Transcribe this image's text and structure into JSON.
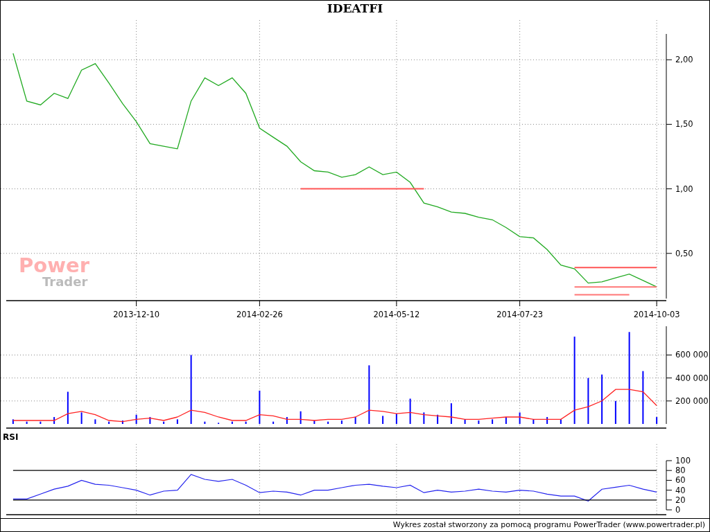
{
  "title": "IDEATFI",
  "logo": {
    "line_1": "Power",
    "line_2": "Trader"
  },
  "price_chart": {
    "chart_data": {
      "type": "line",
      "grid": true,
      "categories": [
        null,
        null,
        null,
        null,
        null,
        null,
        null,
        null,
        null,
        "2013-12-10",
        null,
        null,
        null,
        null,
        null,
        null,
        null,
        null,
        "2014-02-26",
        null,
        null,
        null,
        null,
        null,
        null,
        null,
        null,
        null,
        "2014-05-12",
        null,
        null,
        null,
        null,
        null,
        null,
        null,
        null,
        "2014-07-23",
        null,
        null,
        null,
        null,
        null,
        null,
        null,
        null,
        null,
        "2014-10-03"
      ],
      "series": [
        {
          "color": "#22aa22",
          "values": [
            2.05,
            1.68,
            1.65,
            1.74,
            1.7,
            1.92,
            1.97,
            1.82,
            1.66,
            1.52,
            1.35,
            1.33,
            1.31,
            1.68,
            1.86,
            1.8,
            1.86,
            1.74,
            1.47,
            1.4,
            1.33,
            1.21,
            1.14,
            1.13,
            1.09,
            1.11,
            1.17,
            1.11,
            1.13,
            1.05,
            0.89,
            0.86,
            0.82,
            0.81,
            0.78,
            0.76,
            0.7,
            0.63,
            0.62,
            0.53,
            0.41,
            0.38,
            0.27,
            0.28,
            0.31,
            0.34,
            0.29,
            0.24
          ]
        },
        {
          "color": "#ff5555",
          "values": [
            null,
            null,
            null,
            null,
            null,
            null,
            null,
            null,
            null,
            null,
            null,
            null,
            null,
            null,
            null,
            null,
            null,
            null,
            null,
            null,
            null,
            1.0,
            1.0,
            1.0,
            1.0,
            1.0,
            1.0,
            1.0,
            1.0,
            1.0,
            1.0,
            null,
            null,
            null,
            null,
            null,
            null,
            null,
            null,
            null,
            null,
            null,
            null,
            null,
            null,
            null,
            null,
            null
          ]
        },
        {
          "color": "#ff5555",
          "values": [
            null,
            null,
            null,
            null,
            null,
            null,
            null,
            null,
            null,
            null,
            null,
            null,
            null,
            null,
            null,
            null,
            null,
            null,
            null,
            null,
            null,
            null,
            null,
            null,
            null,
            null,
            null,
            null,
            null,
            null,
            null,
            null,
            null,
            null,
            null,
            null,
            null,
            null,
            null,
            null,
            null,
            0.39,
            0.39,
            0.39,
            0.39,
            0.39,
            0.39,
            0.39
          ]
        },
        {
          "color": "#ff7777",
          "values": [
            null,
            null,
            null,
            null,
            null,
            null,
            null,
            null,
            null,
            null,
            null,
            null,
            null,
            null,
            null,
            null,
            null,
            null,
            null,
            null,
            null,
            null,
            null,
            null,
            null,
            null,
            null,
            null,
            null,
            null,
            null,
            null,
            null,
            null,
            null,
            null,
            null,
            null,
            null,
            null,
            null,
            0.24,
            0.24,
            0.24,
            0.24,
            0.24,
            0.24,
            0.24
          ]
        },
        {
          "color": "#ff7777",
          "values": [
            null,
            null,
            null,
            null,
            null,
            null,
            null,
            null,
            null,
            null,
            null,
            null,
            null,
            null,
            null,
            null,
            null,
            null,
            null,
            null,
            null,
            null,
            null,
            null,
            null,
            null,
            null,
            null,
            null,
            null,
            null,
            null,
            null,
            null,
            null,
            null,
            null,
            null,
            null,
            null,
            null,
            0.18,
            0.18,
            0.18,
            0.18,
            0.18,
            null,
            null
          ]
        }
      ],
      "ylim": [
        0.15,
        2.2
      ],
      "yticks": [
        {
          "value": 0.5,
          "label": "0,50"
        },
        {
          "value": 1.0,
          "label": "1,00"
        },
        {
          "value": 1.5,
          "label": "1,50"
        },
        {
          "value": 2.0,
          "label": "2,00"
        }
      ]
    }
  },
  "volume_chart": {
    "chart_data": {
      "type": "bar",
      "grid": true,
      "categories": [
        null,
        null,
        null,
        null,
        null,
        null,
        null,
        null,
        null,
        null,
        null,
        null,
        null,
        null,
        null,
        null,
        null,
        null,
        null,
        null,
        null,
        null,
        null,
        null,
        null,
        null,
        null,
        null,
        null,
        null,
        null,
        null,
        null,
        null,
        null,
        null,
        null,
        null,
        null,
        null,
        null,
        null,
        null,
        null,
        null,
        null,
        null,
        null
      ],
      "series": [
        {
          "color": "#0000ff",
          "values": [
            40000,
            20000,
            20000,
            60000,
            280000,
            100000,
            40000,
            20000,
            30000,
            80000,
            60000,
            20000,
            40000,
            600000,
            20000,
            10000,
            20000,
            20000,
            290000,
            20000,
            60000,
            110000,
            30000,
            20000,
            30000,
            60000,
            510000,
            70000,
            90000,
            220000,
            100000,
            80000,
            180000,
            40000,
            30000,
            40000,
            60000,
            100000,
            40000,
            60000,
            40000,
            760000,
            400000,
            430000,
            200000,
            800000,
            460000,
            60000
          ]
        },
        {
          "type": "line",
          "color": "#ff2222",
          "values": [
            30000,
            30000,
            30000,
            30000,
            90000,
            110000,
            80000,
            30000,
            20000,
            40000,
            50000,
            30000,
            60000,
            120000,
            100000,
            60000,
            30000,
            30000,
            80000,
            70000,
            40000,
            40000,
            30000,
            40000,
            40000,
            60000,
            120000,
            110000,
            90000,
            100000,
            80000,
            70000,
            60000,
            40000,
            40000,
            50000,
            60000,
            60000,
            40000,
            40000,
            40000,
            120000,
            150000,
            200000,
            300000,
            300000,
            280000,
            160000
          ]
        }
      ],
      "ylim": [
        0,
        850000
      ],
      "yticks": [
        {
          "value": 200000,
          "label": "200 000"
        },
        {
          "value": 400000,
          "label": "400 000"
        },
        {
          "value": 600000,
          "label": "600 000"
        }
      ]
    }
  },
  "rsi_panel": {
    "label": "RSI",
    "chart_data": {
      "type": "line",
      "grid": true,
      "categories": [
        null,
        null,
        null,
        null,
        null,
        null,
        null,
        null,
        null,
        null,
        null,
        null,
        null,
        null,
        null,
        null,
        null,
        null,
        null,
        null,
        null,
        null,
        null,
        null,
        null,
        null,
        null,
        null,
        null,
        null,
        null,
        null,
        null,
        null,
        null,
        null,
        null,
        null,
        null,
        null,
        null,
        null,
        null,
        null,
        null,
        null,
        null,
        null
      ],
      "series": [
        {
          "color": "#2222ee",
          "values": [
            22,
            22,
            32,
            42,
            48,
            60,
            52,
            50,
            45,
            40,
            30,
            38,
            40,
            72,
            62,
            58,
            62,
            50,
            35,
            38,
            36,
            30,
            40,
            40,
            45,
            50,
            52,
            48,
            45,
            50,
            35,
            40,
            36,
            38,
            42,
            38,
            36,
            40,
            38,
            32,
            28,
            28,
            18,
            42,
            46,
            50,
            42,
            36
          ]
        },
        {
          "color": "#000000",
          "values": [
            80,
            80,
            80,
            80,
            80,
            80,
            80,
            80,
            80,
            80,
            80,
            80,
            80,
            80,
            80,
            80,
            80,
            80,
            80,
            80,
            80,
            80,
            80,
            80,
            80,
            80,
            80,
            80,
            80,
            80,
            80,
            80,
            80,
            80,
            80,
            80,
            80,
            80,
            80,
            80,
            80,
            80,
            80,
            80,
            80,
            80,
            80,
            80
          ]
        },
        {
          "color": "#000000",
          "values": [
            20,
            20,
            20,
            20,
            20,
            20,
            20,
            20,
            20,
            20,
            20,
            20,
            20,
            20,
            20,
            20,
            20,
            20,
            20,
            20,
            20,
            20,
            20,
            20,
            20,
            20,
            20,
            20,
            20,
            20,
            20,
            20,
            20,
            20,
            20,
            20,
            20,
            20,
            20,
            20,
            20,
            20,
            20,
            20,
            20,
            20,
            20,
            20
          ]
        }
      ],
      "ylim": [
        0,
        100
      ],
      "yticks": [
        {
          "value": 0,
          "label": "0"
        },
        {
          "value": 20,
          "label": "20"
        },
        {
          "value": 40,
          "label": "40"
        },
        {
          "value": 60,
          "label": "60"
        },
        {
          "value": 80,
          "label": "80"
        },
        {
          "value": 100,
          "label": "100"
        }
      ]
    }
  },
  "footer": "Wykres został stworzony za pomocą programu PowerTrader (www.powertrader.pl)"
}
